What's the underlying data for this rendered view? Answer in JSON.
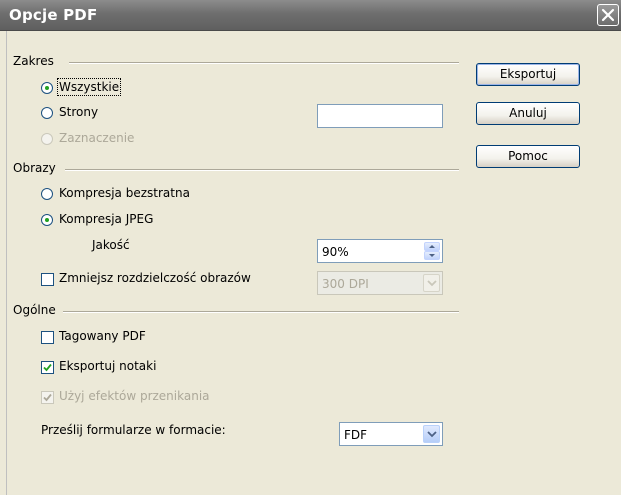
{
  "window": {
    "title": "Opcje PDF"
  },
  "range": {
    "section_label": "Zakres",
    "all_label": "Wszystkie",
    "pages_label": "Strony",
    "pages_value": "",
    "selection_label": "Zaznaczenie"
  },
  "images": {
    "section_label": "Obrazy",
    "lossless_label": "Kompresja bezstratna",
    "jpeg_label": "Kompresja JPEG",
    "quality_label": "Jakość",
    "quality_value": "90%",
    "reduce_label": "Zmniejsz rozdzielczość obrazów",
    "resolution_value": "300 DPI"
  },
  "general": {
    "section_label": "Ogólne",
    "tagged_label": "Tagowany PDF",
    "notes_label": "Eksportuj notaki",
    "transitions_label": "Użyj efektów przenikania",
    "form_label": "Prześlij formularze w formacie:",
    "form_value": "FDF"
  },
  "buttons": {
    "export_label": "Eksportuj",
    "cancel_label": "Anuluj",
    "help_label": "Pomoc"
  },
  "state": {
    "range_selected": "all",
    "compression_selected": "jpeg",
    "reduce_resolution": false,
    "tagged_pdf": false,
    "export_notes": true,
    "use_transitions": true
  },
  "colors": {
    "titlebar": "#6e6e6e",
    "dialog_bg": "#ece9d8",
    "check_mark": "#21a121"
  }
}
